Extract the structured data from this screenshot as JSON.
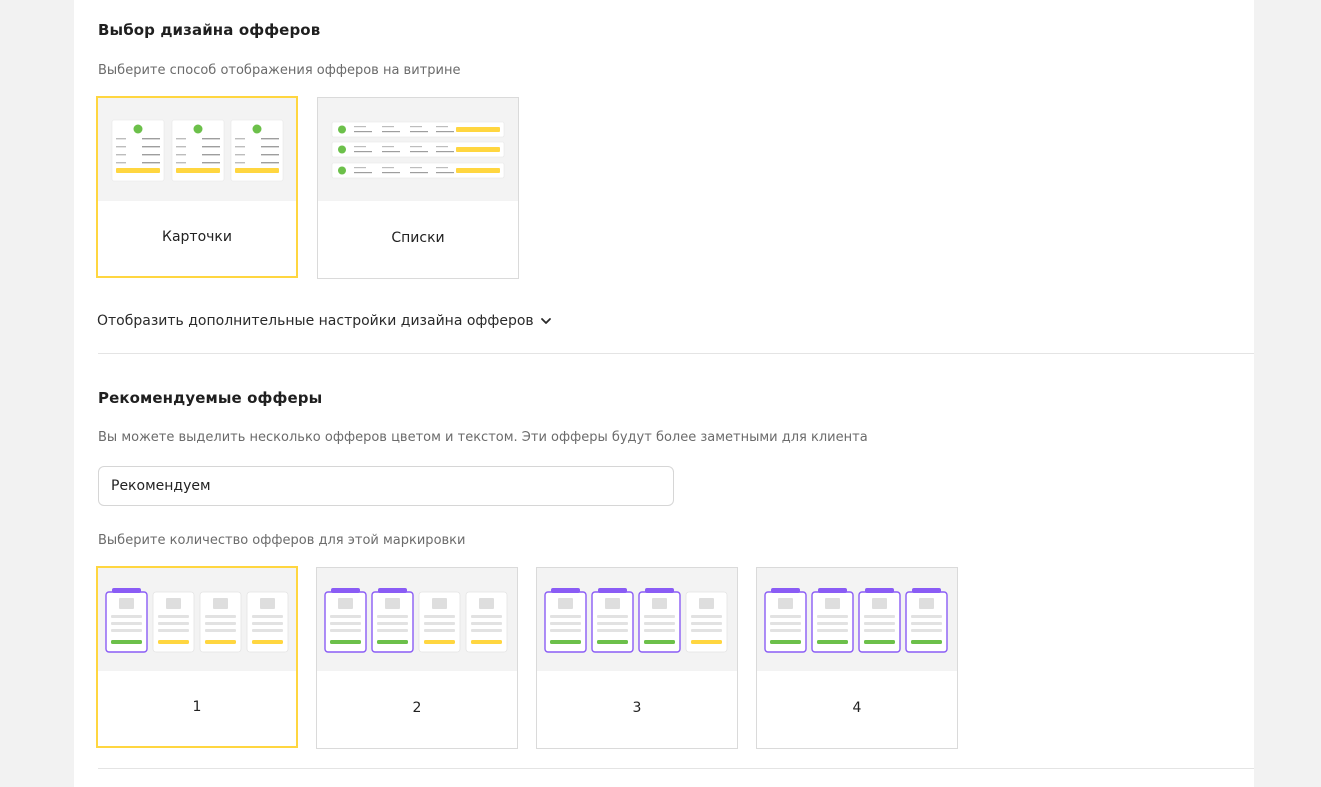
{
  "design": {
    "title": "Выбор дизайна офферов",
    "description": "Выберите способ отображения офферов на витрине",
    "options": [
      {
        "label": "Карточки",
        "selected": true
      },
      {
        "label": "Списки",
        "selected": false
      }
    ],
    "more_settings_link": "Отобразить дополнительные настройки дизайна офферов",
    "more_settings_icon": "chevron-down-icon"
  },
  "recommended": {
    "title": "Рекомендуемые офферы",
    "description": "Вы можете выделить несколько офферов цветом и текстом. Эти офферы будут более заметными для клиента",
    "label_value": "Рекомендуем",
    "count_description": "Выберите количество офферов для этой маркировки",
    "count_options": [
      {
        "label": "1",
        "highlighted": 1,
        "selected": true
      },
      {
        "label": "2",
        "highlighted": 2,
        "selected": false
      },
      {
        "label": "3",
        "highlighted": 3,
        "selected": false
      },
      {
        "label": "4",
        "highlighted": 4,
        "selected": false
      }
    ]
  },
  "colors": {
    "selected_border": "#ffd640",
    "highlight_purple": "#8a5cf5",
    "button_yellow": "#ffd640",
    "button_green": "#6cc04a"
  }
}
